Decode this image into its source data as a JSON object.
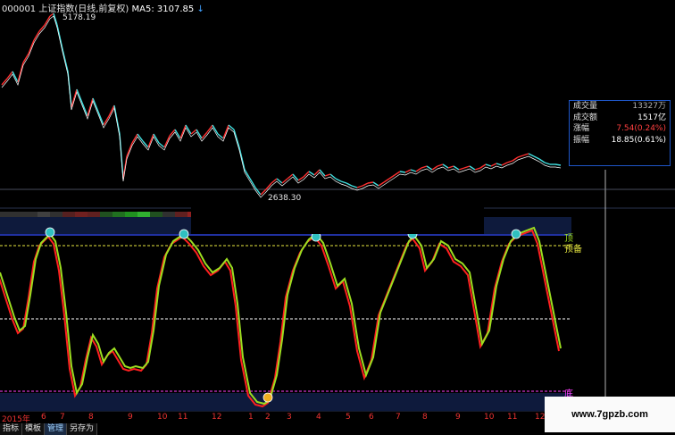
{
  "header": {
    "code_title": "000001 上证指数(日线,前复权)",
    "ma_label": "MA5: 3107.85"
  },
  "price": {
    "high_label": "5178.19",
    "low_label": "2638.30"
  },
  "info_box": {
    "rows": [
      {
        "k": "成交量",
        "v": "13327万"
      },
      {
        "k": "成交额",
        "v": "1517亿"
      },
      {
        "k": "涨幅",
        "v": "7.54(0.24%)"
      },
      {
        "k": "振幅",
        "v": "18.85(0.61%)"
      }
    ]
  },
  "indicator": {
    "top_label": "顶",
    "mid_label": "预备",
    "bottom_label": "底"
  },
  "timeline": {
    "labels": [
      "2015年",
      "6",
      "7",
      "8",
      "9",
      "10",
      "11",
      "12",
      "1",
      "2",
      "3",
      "4",
      "5",
      "6",
      "7",
      "8",
      "9",
      "10",
      "11",
      "12"
    ]
  },
  "tabs": [
    "指标",
    "模板",
    "管理",
    "另存为"
  ],
  "watermark": "www.7gpzb.com",
  "colors": {
    "up": "#ff3030",
    "down": "#40e0e0",
    "osc_main": "#9cde20",
    "osc_second": "#ff2020",
    "dashed": "#e8e840",
    "magenta": "#ff40ff",
    "blue_box": "#1e56c8"
  }
}
